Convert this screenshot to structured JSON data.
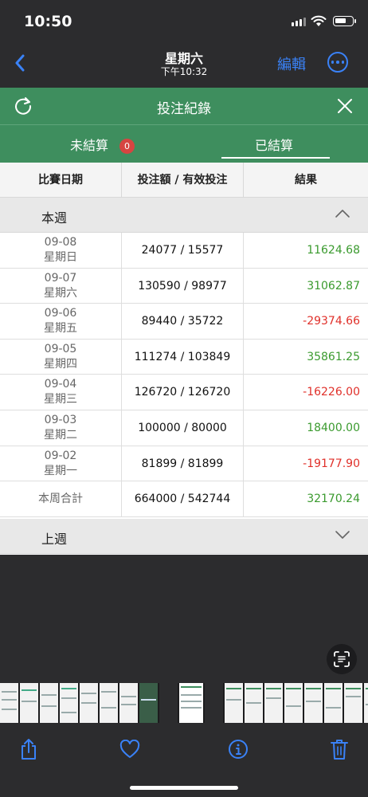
{
  "status": {
    "time": "10:50"
  },
  "nav": {
    "title": "星期六",
    "subtitle": "下午10:32",
    "edit": "編輯"
  },
  "app": {
    "header_title": "投注紀錄",
    "tabs": [
      {
        "label": "未結算",
        "badge": "0"
      },
      {
        "label": "已結算"
      }
    ],
    "columns": [
      "比賽日期",
      "投注額 / 有效投注",
      "結果"
    ],
    "this_week_label": "本週",
    "last_week_label": "上週",
    "rows": [
      {
        "date": "09-08",
        "weekday": "星期日",
        "amount": "24077 / 15577",
        "result": "11624.68",
        "color": "#3a9a2e"
      },
      {
        "date": "09-07",
        "weekday": "星期六",
        "amount": "130590 / 98977",
        "result": "31062.87",
        "color": "#3a9a2e"
      },
      {
        "date": "09-06",
        "weekday": "星期五",
        "amount": "89440 / 35722",
        "result": "-29374.66",
        "color": "#e0302a"
      },
      {
        "date": "09-05",
        "weekday": "星期四",
        "amount": "111274 / 103849",
        "result": "35861.25",
        "color": "#3a9a2e"
      },
      {
        "date": "09-04",
        "weekday": "星期三",
        "amount": "126720 / 126720",
        "result": "-16226.00",
        "color": "#e0302a"
      },
      {
        "date": "09-03",
        "weekday": "星期二",
        "amount": "100000 / 80000",
        "result": "18400.00",
        "color": "#3a9a2e"
      },
      {
        "date": "09-02",
        "weekday": "星期一",
        "amount": "81899 / 81899",
        "result": "-19177.90",
        "color": "#e0302a"
      }
    ],
    "total": {
      "label": "本周合計",
      "amount": "664000 / 542744",
      "result": "32170.24",
      "color": "#3a9a2e"
    }
  },
  "colors": {
    "header_green": "#3e8e5e",
    "ios_blue": "#3a82f7",
    "positive": "#3a9a2e",
    "negative": "#e0302a"
  },
  "icons": [
    "back-chevron-icon",
    "more-icon",
    "refresh-icon",
    "close-icon",
    "chevron-up-icon",
    "chevron-down-icon",
    "live-text-icon",
    "share-icon",
    "heart-icon",
    "info-icon",
    "trash-icon"
  ]
}
